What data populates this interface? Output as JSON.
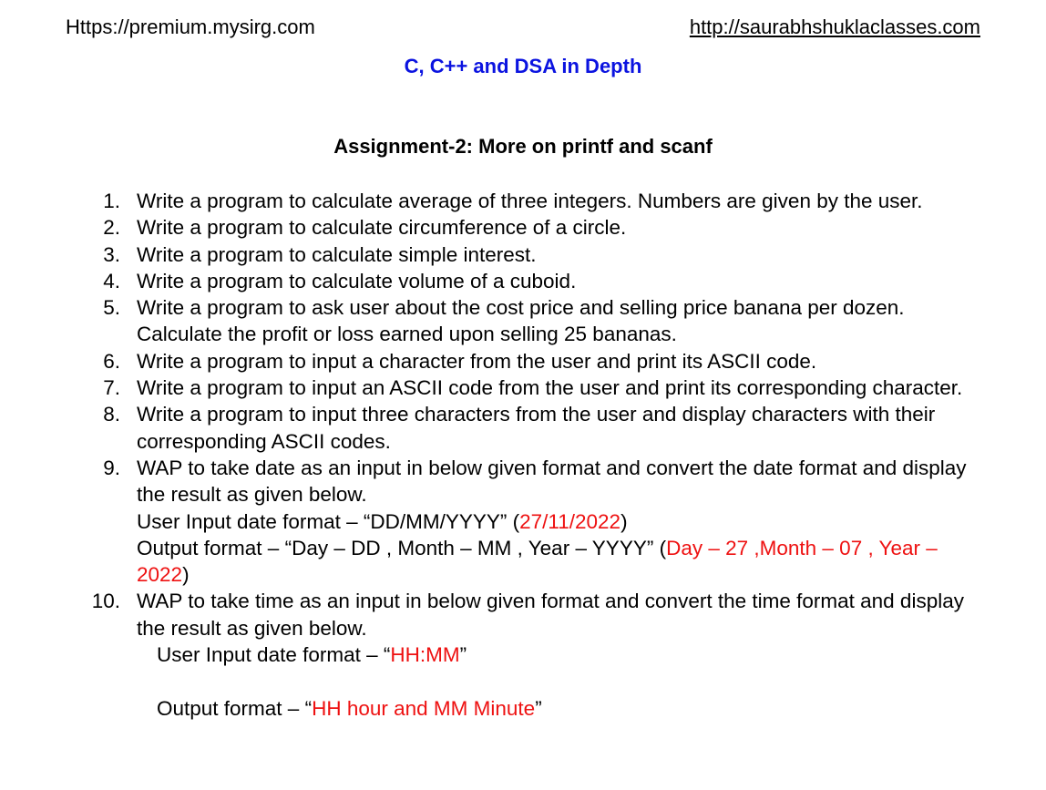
{
  "header": {
    "left": "Https://premium.mysirg.com",
    "right": "http://saurabhshuklaclasses.com"
  },
  "title": "C, C++ and DSA in Depth",
  "assignment_heading": "Assignment-2: More on printf and scanf",
  "colors": {
    "title": "#0b13e0",
    "highlight": "#ee1111"
  },
  "questions": [
    {
      "num": "1.",
      "text": "Write a program to calculate average of three integers. Numbers are given by the user."
    },
    {
      "num": "2.",
      "text": "Write a program to calculate circumference of a circle."
    },
    {
      "num": "3.",
      "text": "Write a program to calculate simple interest."
    },
    {
      "num": "4.",
      "text": "Write a program to calculate volume of a cuboid."
    },
    {
      "num": "5.",
      "text": "Write a program to ask user about the cost price and selling price banana per dozen. Calculate the profit or loss earned upon selling 25 bananas."
    },
    {
      "num": "6.",
      "text": "Write a program to input a character from the user and print its ASCII code."
    },
    {
      "num": "7.",
      "text": "Write a program to input an ASCII code from the user and print its corresponding character."
    },
    {
      "num": "8.",
      "text": "Write a program to input three characters from the user and display characters with their corresponding ASCII codes."
    },
    {
      "num": "9.",
      "text": "WAP to take date as an input in below given format and convert the date format and display the result as given below.",
      "input_label": "User Input date format – “DD/MM/YYYY”  (",
      "input_example": "27/11/2022",
      "input_close": ")",
      "output_label": "Output format – “Day – DD , Month – MM , Year – YYYY” (",
      "output_example": "Day – 27 ,Month – 07 , Year – 2022",
      "output_close": ")"
    },
    {
      "num": "10.",
      "text": "WAP to take time as an input in below given format and convert the time format and display the result as given below.",
      "input_label": "User Input date format – “",
      "input_example": "HH:MM",
      "input_close": "”",
      "output_label": "Output format – “",
      "output_example": "HH hour and MM Minute",
      "output_close": "”"
    }
  ]
}
